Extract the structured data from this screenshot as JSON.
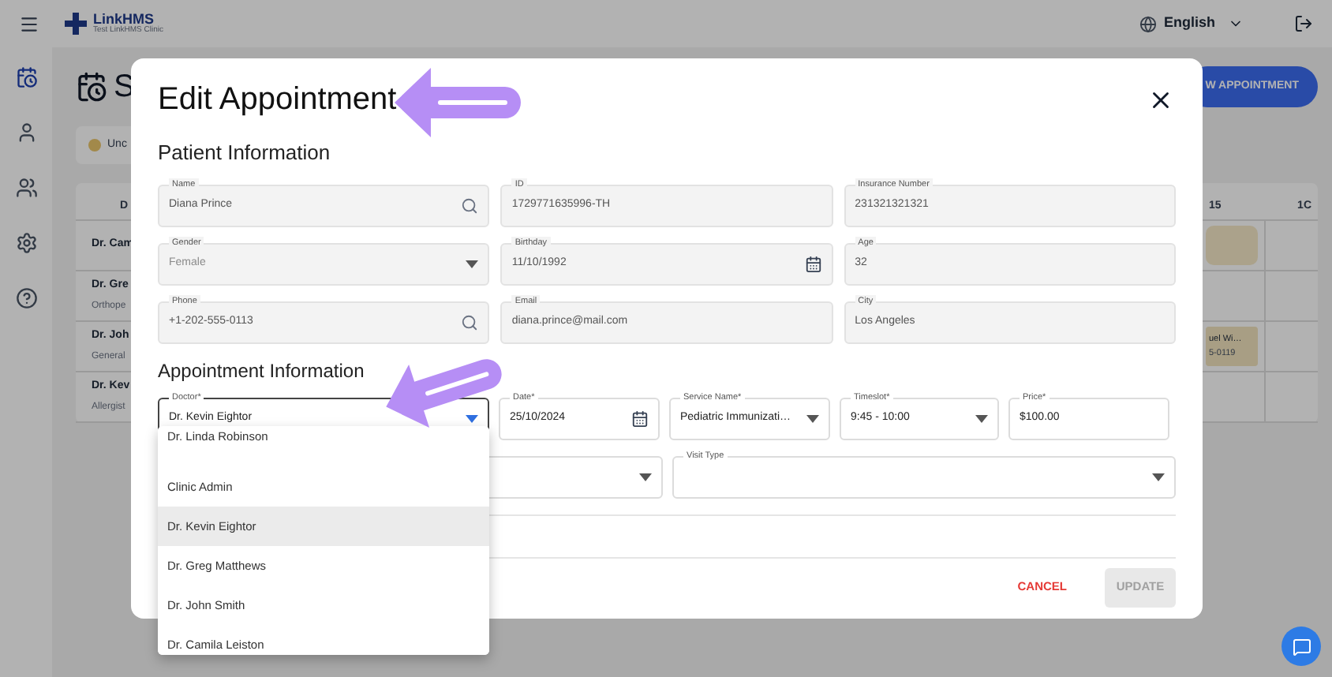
{
  "app": {
    "brand": "LinkHMS",
    "clinic": "Test LinkHMS Clinic",
    "language": "English"
  },
  "sidebar": {
    "items": [
      {
        "kind": "calendar",
        "selected": true
      },
      {
        "kind": "person",
        "selected": false
      },
      {
        "kind": "group",
        "selected": false
      },
      {
        "kind": "settings",
        "selected": false
      },
      {
        "kind": "help",
        "selected": false
      }
    ]
  },
  "page": {
    "title": "S",
    "new_button": "W APPOINTMENT",
    "filter_chip": "Unc",
    "table": {
      "columns": [
        "D",
        "15",
        "1C"
      ],
      "rows": [
        {
          "name": "Dr. Cam",
          "appointment": {
            "kind": "blank"
          }
        },
        {
          "name": "Dr. Gre",
          "specialty": "Orthope"
        },
        {
          "name": "Dr. Joh",
          "specialty": "General",
          "appointment": {
            "kind": "text",
            "title": "uel Wi…",
            "subtitle": "5-0119"
          }
        },
        {
          "name": "Dr. Kev",
          "specialty": "Allergist"
        }
      ]
    }
  },
  "dialog": {
    "title": "Edit Appointment",
    "patient": {
      "title": "Patient Information",
      "fields": [
        {
          "label": "Name",
          "value": "Diana  Prince",
          "kind": "search",
          "disabled": true
        },
        {
          "label": "ID",
          "value": "1729771635996-TH",
          "kind": "text",
          "disabled": true
        },
        {
          "label": "Insurance Number",
          "value": "231321321321",
          "kind": "text",
          "disabled": true
        },
        {
          "label": "Gender",
          "value": "Female",
          "kind": "select",
          "disabled": true
        },
        {
          "label": "Birthday",
          "value": "11/10/1992",
          "kind": "date",
          "disabled": true
        },
        {
          "label": "Age",
          "value": "32",
          "kind": "text",
          "disabled": true
        },
        {
          "label": "Phone",
          "value": "+1-202-555-0113",
          "kind": "search",
          "disabled": true
        },
        {
          "label": "Email",
          "value": "diana.prince@mail.com",
          "kind": "text",
          "disabled": true
        },
        {
          "label": "City",
          "value": "Los Angeles",
          "kind": "text",
          "disabled": true
        }
      ]
    },
    "appointment": {
      "title": "Appointment Information",
      "fields": [
        {
          "label": "Doctor*",
          "value": "Dr. Kevin Eightor",
          "kind": "select",
          "focused": true
        },
        {
          "label": "Date*",
          "value": "25/10/2024",
          "kind": "date",
          "focused": false
        },
        {
          "label": "Service Name*",
          "value": "Pediatric Immunizati…",
          "kind": "select",
          "focused": false
        },
        {
          "label": "Timeslot*",
          "value": "9:45 - 10:00",
          "kind": "select",
          "focused": false
        },
        {
          "label": "Price*",
          "value": "$100.00",
          "kind": "text",
          "focused": false
        }
      ],
      "fields_2": [
        {
          "kind": "select"
        },
        {
          "label": "Visit Type",
          "kind": "select"
        }
      ]
    },
    "doctor_options": [
      {
        "label": "Dr. Linda Robinson",
        "selected": false
      },
      {
        "label": "Clinic Admin",
        "selected": false
      },
      {
        "label": "Dr. Kevin Eightor",
        "selected": true
      },
      {
        "label": "Dr. Greg Matthews",
        "selected": false
      },
      {
        "label": "Dr. John Smith",
        "selected": false
      },
      {
        "label": "Dr. Camila Leiston",
        "selected": false
      }
    ],
    "buttons": {
      "cancel": "CANCEL",
      "update": "UPDATE",
      "update_disabled": true
    }
  }
}
